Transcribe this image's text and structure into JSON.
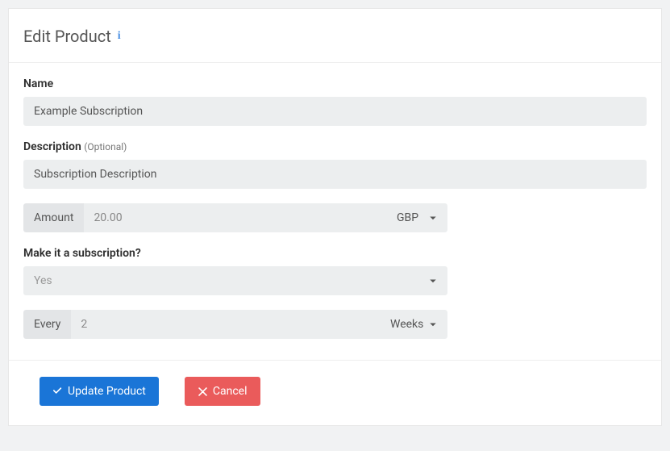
{
  "header": {
    "title": "Edit Product"
  },
  "form": {
    "name": {
      "label": "Name",
      "value": "Example Subscription"
    },
    "description": {
      "label": "Description",
      "optional": "(Optional)",
      "value": "Subscription Description"
    },
    "amount": {
      "addon": "Amount",
      "value": "20.00",
      "currency": "GBP"
    },
    "subscription": {
      "label": "Make it a subscription?",
      "value": "Yes"
    },
    "interval": {
      "addon": "Every",
      "value": "2",
      "unit": "Weeks"
    }
  },
  "actions": {
    "update": "Update Product",
    "cancel": "Cancel"
  }
}
